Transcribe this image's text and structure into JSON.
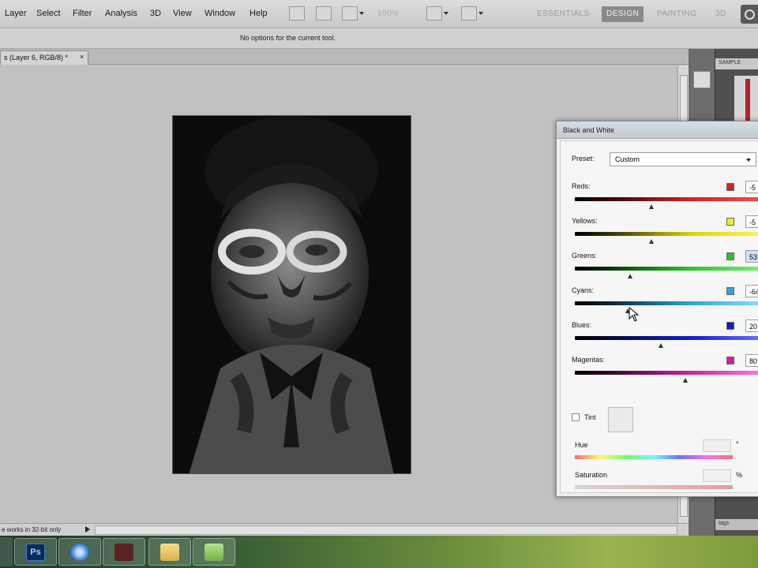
{
  "menubar": {
    "items": [
      "Layer",
      "Select",
      "Filter",
      "Analysis",
      "3D",
      "View",
      "Window",
      "Help"
    ],
    "workspaces": {
      "essentials": "ESSENTIALS",
      "design": "DESIGN",
      "painting": "PAINTING",
      "threed": "3D"
    },
    "zoom": "100%"
  },
  "options_bar": {
    "text": "No options for the current tool."
  },
  "document": {
    "tab_title": "s (Layer 6, RGB/8) *",
    "tab_close": "×"
  },
  "status": {
    "text": "e works in 32-bit only"
  },
  "dock": {
    "panel_tab": "SAMPLE",
    "bottom_label": "tags"
  },
  "bw_dialog": {
    "title": "Black and White",
    "preset_label": "Preset:",
    "preset_value": "Custom",
    "sliders": [
      {
        "label": "Reds:",
        "value": "-5",
        "color": "#d62020"
      },
      {
        "label": "Yellows:",
        "value": "-5",
        "color": "#e6e000"
      },
      {
        "label": "Greens:",
        "value": "53",
        "color": "#2cc42c"
      },
      {
        "label": "Cyans:",
        "value": "-64",
        "color": "#2aa6d8"
      },
      {
        "label": "Blues:",
        "value": "20",
        "color": "#1020c8"
      },
      {
        "label": "Magentas:",
        "value": "80",
        "color": "#d0209c"
      }
    ],
    "tint_label": "Tint",
    "hue_label": "Hue",
    "hue_unit": "°",
    "saturation_label": "Saturation",
    "saturation_unit": "%"
  },
  "taskbar": {
    "ps_label": "Ps"
  }
}
